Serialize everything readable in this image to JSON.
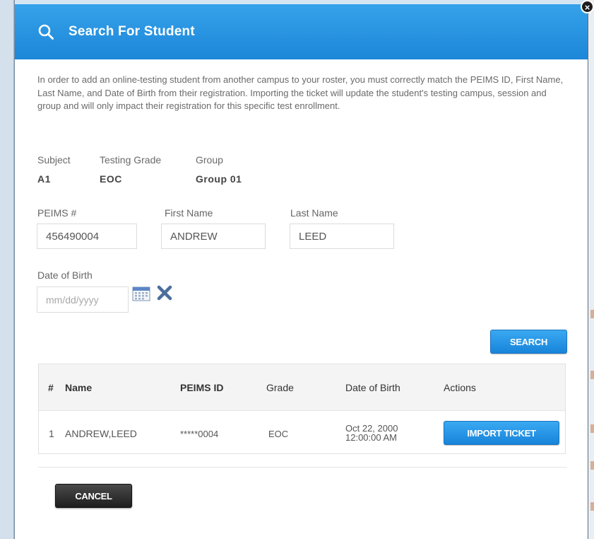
{
  "dialog": {
    "title": "Search For Student",
    "intro": "In order to add an online-testing student from another campus to your roster, you must correctly match the PEIMS ID, First Name, Last Name, and Date of Birth from their registration. Importing the ticket will update the student's testing campus, session and group and will only impact their registration for this specific test enrollment."
  },
  "info": {
    "subject_label": "Subject",
    "subject_value": "A1",
    "grade_label": "Testing Grade",
    "grade_value": "EOC",
    "group_label": "Group",
    "group_value": "Group 01"
  },
  "form": {
    "peims_label": "PEIMS #",
    "peims_value": "456490004",
    "first_label": "First Name",
    "first_value": "ANDREW",
    "last_label": "Last Name",
    "last_value": "LEED",
    "dob_label": "Date of Birth",
    "dob_value": "",
    "dob_placeholder": "mm/dd/yyyy"
  },
  "buttons": {
    "search": "SEARCH",
    "import": "IMPORT TICKET",
    "cancel": "CANCEL"
  },
  "results": {
    "headers": [
      "#",
      "Name",
      "PEIMS ID",
      "Grade",
      "Date of Birth",
      "Actions"
    ],
    "rows": [
      {
        "num": "1",
        "name": "ANDREW,LEED",
        "peims": "*****0004",
        "grade": "EOC",
        "dob_date": "Oct 22, 2000",
        "dob_time": "12:00:00 AM"
      }
    ]
  },
  "colors": {
    "header_blue": "#1c86d8",
    "button_blue": "#1784da",
    "cancel_dark": "#1e1e1e"
  },
  "icons": {
    "header": "search-icon",
    "calendar": "calendar-icon",
    "clear": "clear-x-icon",
    "close": "close-icon"
  }
}
